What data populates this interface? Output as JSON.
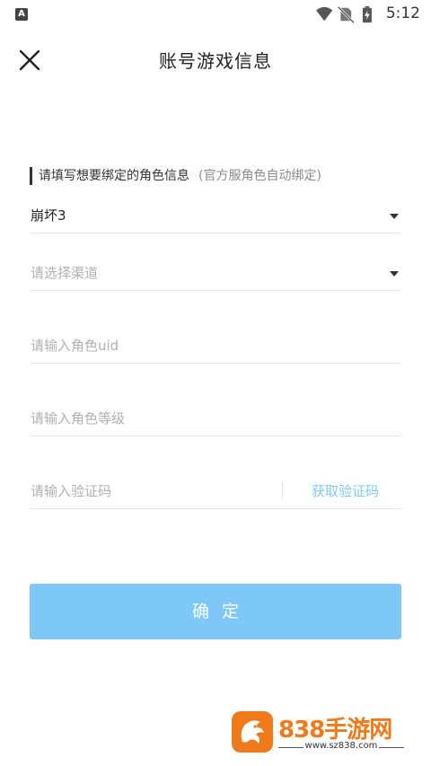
{
  "status_bar": {
    "app_badge": "A",
    "time": "5:12",
    "icons": [
      "wifi-icon",
      "no-sim-icon",
      "battery-charging-icon"
    ]
  },
  "header": {
    "title": "账号游戏信息",
    "close_icon": "close-icon"
  },
  "form": {
    "section_label": "请填写想要绑定的角色信息",
    "section_note": "(官方服角色自动绑定)",
    "game_select": {
      "value": "崩坏3"
    },
    "channel_select": {
      "placeholder": "请选择渠道"
    },
    "uid_input": {
      "placeholder": "请输入角色uid"
    },
    "level_input": {
      "placeholder": "请输入角色等级"
    },
    "code_input": {
      "placeholder": "请输入验证码"
    },
    "get_code_label": "获取验证码",
    "confirm_label": "确定"
  },
  "watermark": {
    "title": "838手游网",
    "url": "www.sz838.com"
  },
  "colors": {
    "accent": "#7ec8f8",
    "watermark_brand": "#f07a1a",
    "placeholder": "#b0b0b0",
    "divider": "#e6e6e6"
  }
}
